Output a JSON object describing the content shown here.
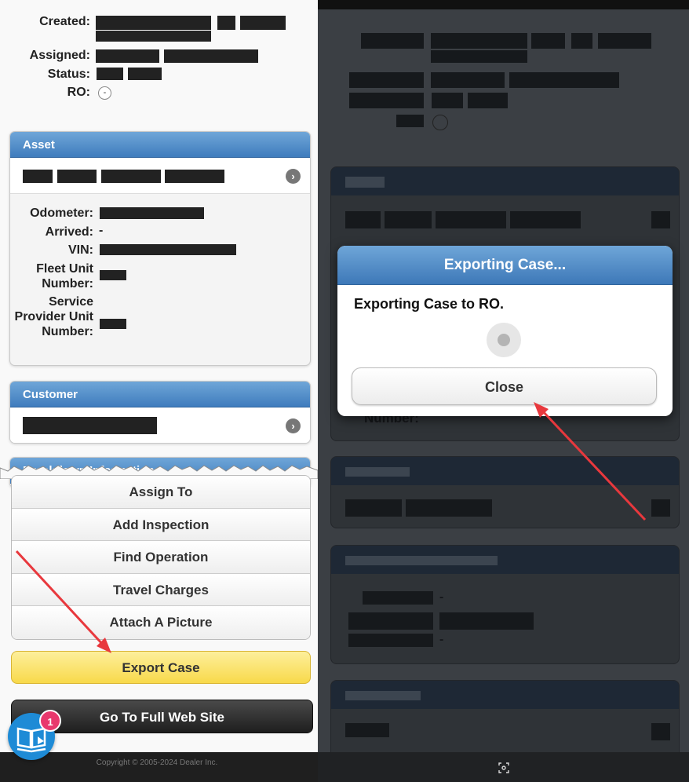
{
  "case_header": {
    "created_label": "Created:",
    "assigned_label": "Assigned:",
    "status_label": "Status:",
    "ro_label": "RO:",
    "ro_value": "-"
  },
  "asset": {
    "title": "Asset",
    "odometer_label": "Odometer:",
    "arrived_label": "Arrived:",
    "arrived_value": "-",
    "vin_label": "VIN:",
    "fleet_unit_label": "Fleet Unit Number:",
    "sp_unit_label": "Service Provider Unit Number:"
  },
  "customer": {
    "title": "Customer"
  },
  "breakdown": {
    "title": "Breakdown Information"
  },
  "actions": {
    "items": [
      "Assign To",
      "Add Inspection",
      "Find Operation",
      "Travel Charges",
      "Attach A Picture"
    ],
    "export_label": "Export Case",
    "full_site_label": "Go To Full Web Site"
  },
  "footer": {
    "text": "Copyright © 2005-2024 Dealer Inc."
  },
  "help": {
    "badge_count": "1"
  },
  "dialog": {
    "title": "Exporting Case...",
    "message": "Exporting Case to RO.",
    "close_label": "Close"
  },
  "right_background": {
    "number_fragment": "Number:",
    "dash": "-"
  },
  "colors": {
    "header_blue": "#3f7cbd",
    "export_yellow": "#f8d94a",
    "arrow_red": "#e8383d"
  }
}
